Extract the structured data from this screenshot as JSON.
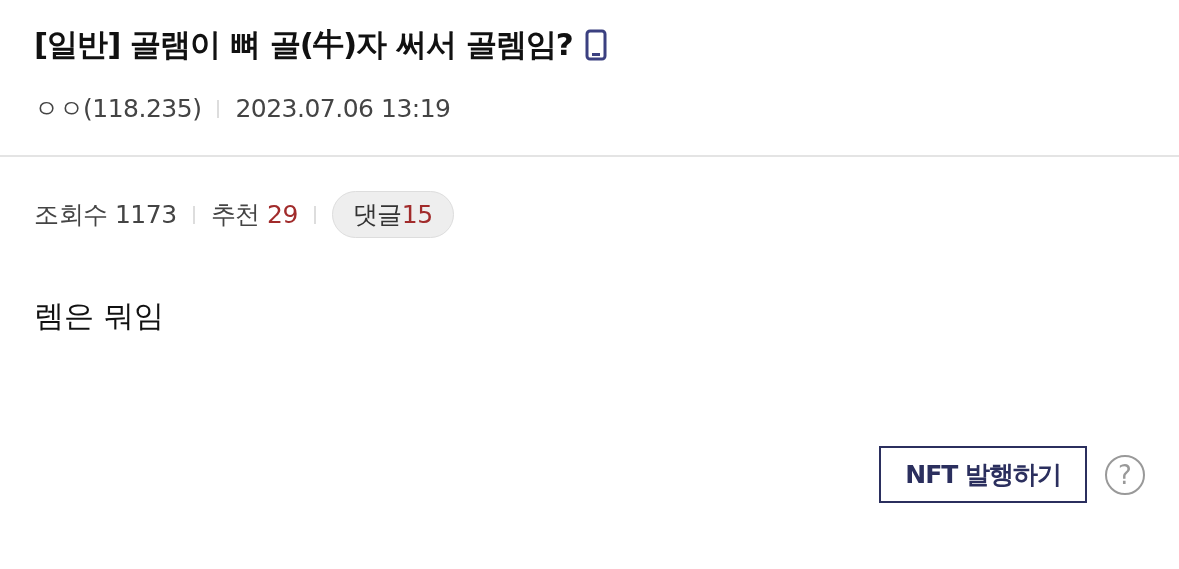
{
  "post": {
    "category": "[일반]",
    "title": "골램이 뼈 골(牛)자 써서 골렘임?",
    "mobile": true,
    "author": "ㅇㅇ(118.235)",
    "date": "2023.07.06 13:19"
  },
  "stats": {
    "views_label": "조회수",
    "views": "1173",
    "recommend_label": "추천",
    "recommend": "29",
    "comments_label": "댓글",
    "comments": "15"
  },
  "body": "렘은 뭐임",
  "nft_button": "NFT 발행하기",
  "help_button": "?"
}
